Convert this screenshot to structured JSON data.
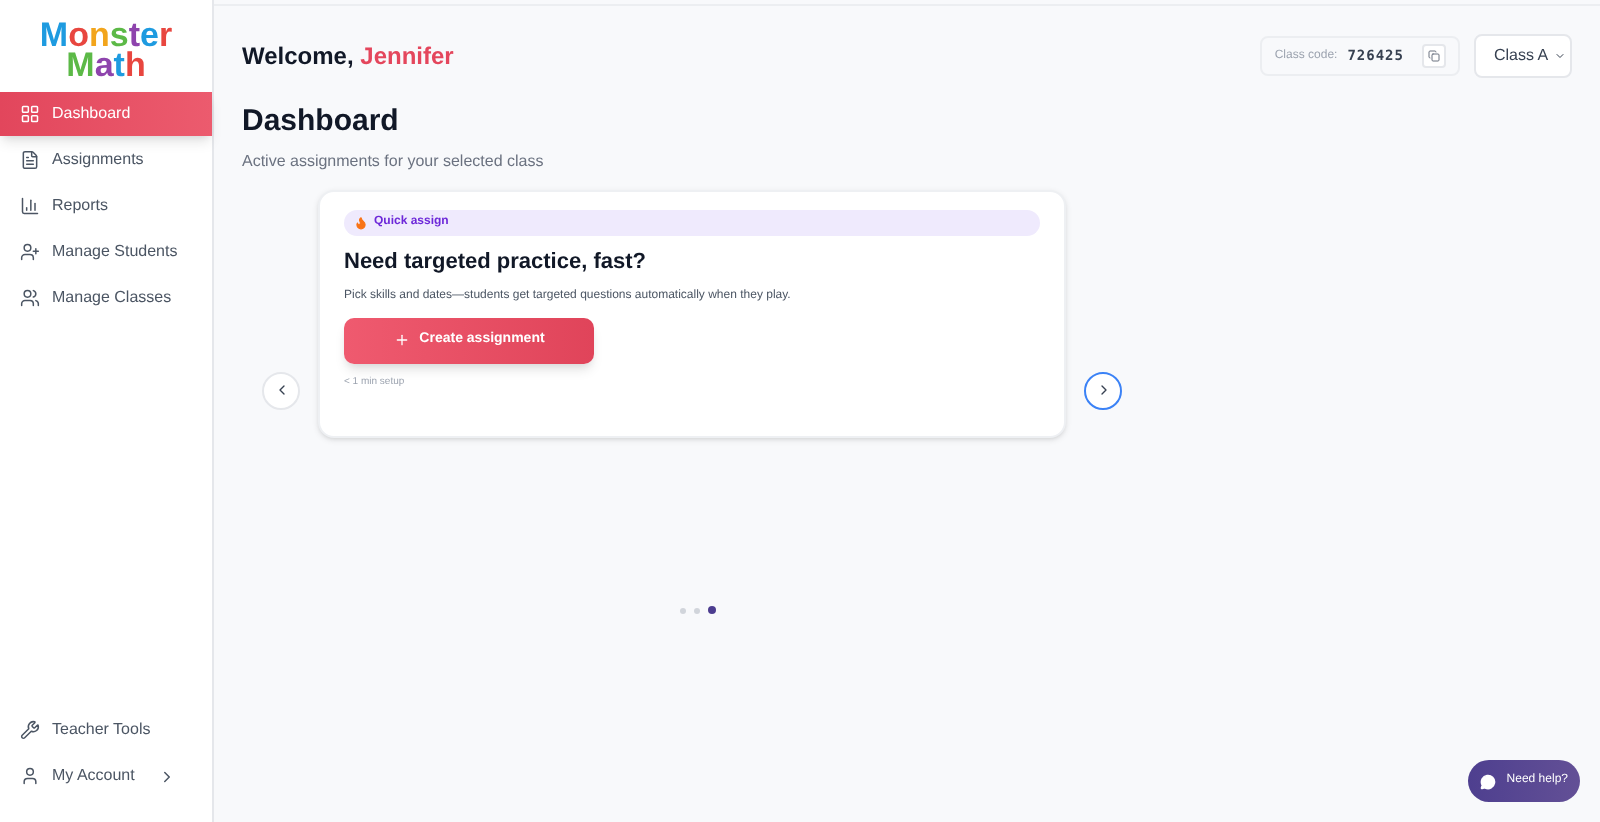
{
  "logo": {
    "line_1": "Monster",
    "line_2": "Math"
  },
  "sidebar": {
    "items": [
      {
        "label": "Dashboard",
        "selected": true
      },
      {
        "label": "Assignments",
        "selected": false
      },
      {
        "label": "Reports",
        "selected": false
      },
      {
        "label": "Manage Students",
        "selected": false
      },
      {
        "label": "Manage Classes",
        "selected": false
      }
    ],
    "bottom_items": [
      {
        "label": "Teacher Tools",
        "submenu": false
      },
      {
        "label": "My Account",
        "submenu": true
      }
    ]
  },
  "header": {
    "greeting": "Welcome,",
    "name": "Jennifer",
    "class_code_label": "Class code:",
    "class_code": "726425",
    "class_select": "Class A"
  },
  "page": {
    "title": "Dashboard",
    "subtitle": "Active assignments for your selected class"
  },
  "card": {
    "badge": "Quick assign",
    "title": "Need targeted practice, fast?",
    "text": "Pick skills and dates—students get targeted questions automatically when they play.",
    "button": "Create assignment",
    "note": "< 1 min setup"
  },
  "carousel": {
    "dots": [
      {
        "selected": false
      },
      {
        "selected": false
      },
      {
        "selected": true
      }
    ]
  },
  "help_button": "Need help?"
}
